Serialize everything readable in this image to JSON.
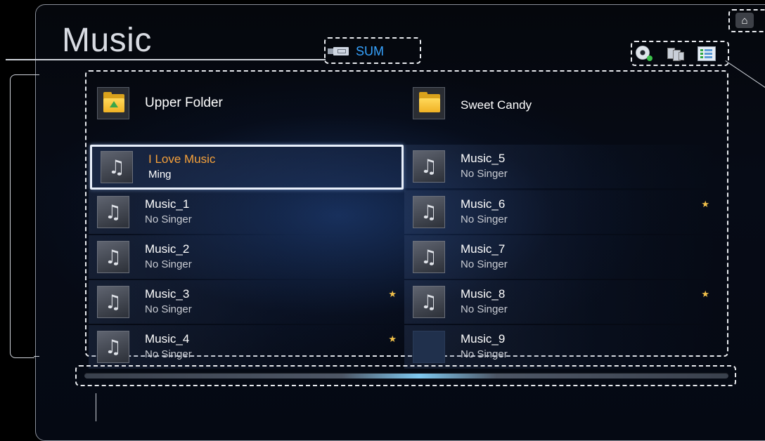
{
  "header": {
    "title": "Music",
    "device_label": "SUM"
  },
  "icons": {
    "home": "home-icon",
    "device": "usb-device-icon",
    "tools": [
      "disc-icon",
      "sort-icon",
      "select-list-icon"
    ]
  },
  "folders": [
    {
      "label": "Upper Folder",
      "icon": "upper-folder-icon"
    },
    {
      "label": "Sweet Candy",
      "icon": "folder-icon"
    }
  ],
  "left_items": [
    {
      "title": "I Love Music",
      "artist": "Ming",
      "selected": true,
      "favorite": false
    },
    {
      "title": "Music_1",
      "artist": "No Singer",
      "selected": false,
      "favorite": false
    },
    {
      "title": "Music_2",
      "artist": "No Singer",
      "selected": false,
      "favorite": false
    },
    {
      "title": "Music_3",
      "artist": "No Singer",
      "selected": false,
      "favorite": true
    },
    {
      "title": "Music_4",
      "artist": "No Singer",
      "selected": false,
      "favorite": true
    }
  ],
  "right_items": [
    {
      "title": "Music_5",
      "artist": "No Singer",
      "selected": false,
      "favorite": false
    },
    {
      "title": "Music_6",
      "artist": "No Singer",
      "selected": false,
      "favorite": true
    },
    {
      "title": "Music_7",
      "artist": "No Singer",
      "selected": false,
      "favorite": false
    },
    {
      "title": "Music_8",
      "artist": "No Singer",
      "selected": false,
      "favorite": true
    },
    {
      "title": "Music_9",
      "artist": "No Singer",
      "selected": false,
      "favorite": false
    }
  ],
  "colors": {
    "accent": "#36a3ff",
    "selected_title": "#f6a13a",
    "favorite_star": "#f2c14a"
  }
}
